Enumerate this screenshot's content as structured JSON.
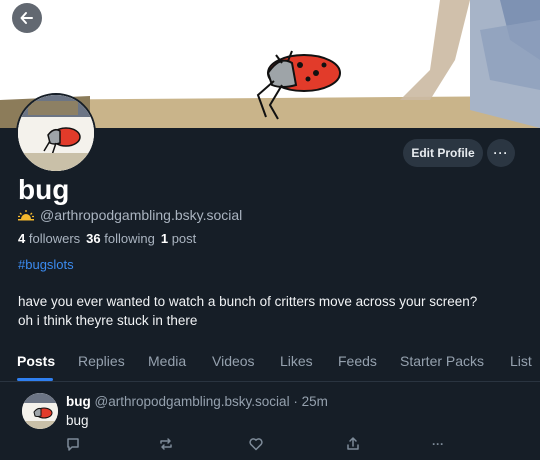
{
  "profile": {
    "display_name": "bug",
    "handle": "@arthropodgambling.bsky.social",
    "followers_count": "4",
    "followers_label": "followers",
    "following_count": "36",
    "following_label": "following",
    "posts_count": "1",
    "posts_label": "post",
    "hashtag": "#bugslots",
    "bio_line1": "have you ever wanted to watch a bunch of critters move across your screen?",
    "bio_line2": "oh i think theyre stuck in there",
    "edit_label": "Edit Profile",
    "more_label": "···"
  },
  "tabs": [
    {
      "label": "Posts",
      "active": true
    },
    {
      "label": "Replies"
    },
    {
      "label": "Media"
    },
    {
      "label": "Videos"
    },
    {
      "label": "Likes"
    },
    {
      "label": "Feeds"
    },
    {
      "label": "Starter Packs"
    },
    {
      "label": "List"
    }
  ],
  "post": {
    "author": "bug",
    "handle": "@arthropodgambling.bsky.social",
    "separator": "·",
    "time": "25m",
    "text": "bug",
    "more_label": "···"
  },
  "icons": {
    "back": "arrow-left-icon",
    "handle_badge": "sunrise-icon",
    "reply": "speech-bubble-icon",
    "repost": "repost-icon",
    "like": "heart-icon",
    "share": "share-icon"
  },
  "colors": {
    "background": "#161e27",
    "accent": "#2f7ff0",
    "link": "#3b8bf0",
    "muted_text": "#95a1ae",
    "button_bg": "#2b3642"
  }
}
